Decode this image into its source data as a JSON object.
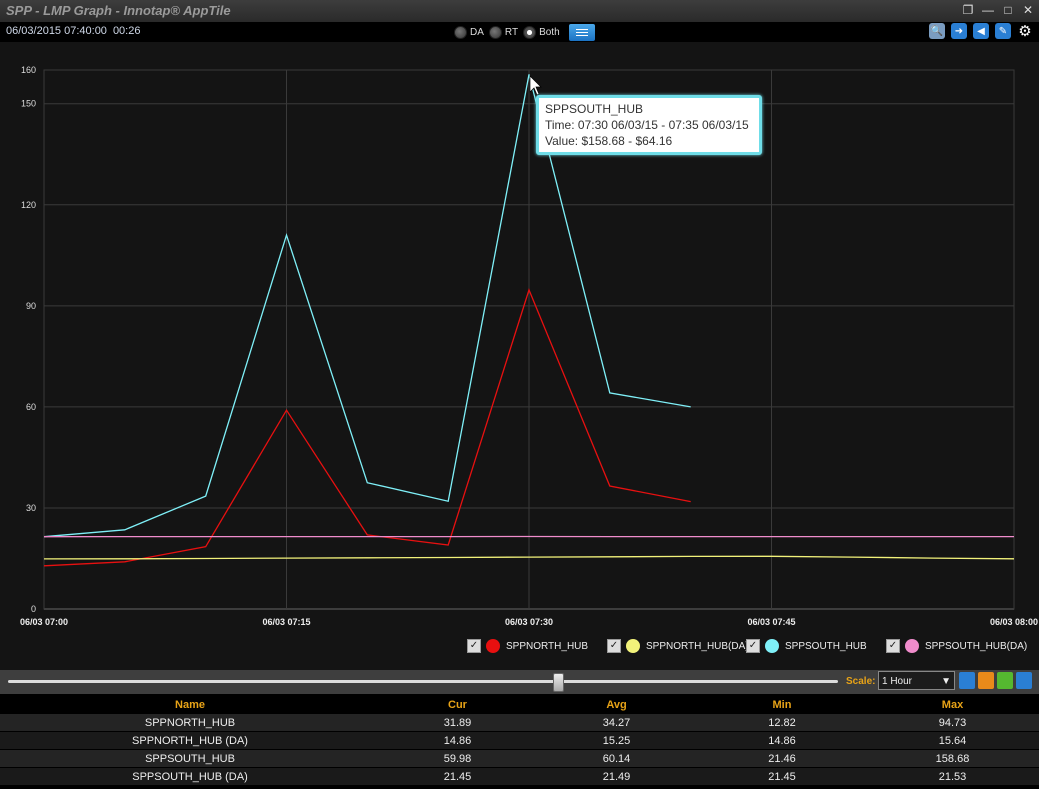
{
  "window": {
    "title": "SPP - LMP Graph - Innotap® AppTile",
    "buttons": [
      "restore-icon",
      "minimize-icon",
      "maximize-icon",
      "close-icon"
    ]
  },
  "toolbar": {
    "date": "06/03/2015 07:40:00",
    "elapsed": "00:26",
    "modes": [
      {
        "label": "DA",
        "selected": false
      },
      {
        "label": "RT",
        "selected": false
      },
      {
        "label": "Both",
        "selected": true
      }
    ],
    "icons": [
      "magnifier-icon",
      "arrow-right-icon",
      "speaker-icon",
      "edit-icon",
      "gear-icon"
    ]
  },
  "tooltip": {
    "series": "SPPSOUTH_HUB",
    "time": "Time: 07:30 06/03/15 - 07:35 06/03/15",
    "value": "Value: $158.68 - $64.16"
  },
  "chart_data": {
    "type": "line",
    "x": [
      "07:00",
      "07:05",
      "07:10",
      "07:15",
      "07:20",
      "07:25",
      "07:30",
      "07:35",
      "07:40",
      "07:45",
      "07:50",
      "07:55",
      "08:00"
    ],
    "xtick_labels": [
      "06/03 07:00",
      "06/03 07:15",
      "06/03 07:30",
      "06/03 07:45",
      "06/03 08:00"
    ],
    "ytick_labels": [
      "0",
      "30",
      "60",
      "90",
      "120",
      "150",
      "160"
    ],
    "ylim": [
      0,
      160
    ],
    "grid": true,
    "legend_placement": "bottom-right",
    "series": [
      {
        "name": "SPPNORTH_HUB",
        "color": "#e81010",
        "values": [
          12.82,
          14,
          18.5,
          59,
          22,
          19,
          94.73,
          36.5,
          31.89
        ]
      },
      {
        "name": "SPPNORTH_HUB(DA)",
        "color": "#f2f27a",
        "values": [
          14.86,
          14.9,
          15,
          15.1,
          15.2,
          15.3,
          15.4,
          15.5,
          15.6,
          15.64,
          15.4,
          15.1,
          14.9
        ]
      },
      {
        "name": "SPPSOUTH_HUB",
        "color": "#7ff0f8",
        "values": [
          21.46,
          23.5,
          33.5,
          111,
          37.5,
          32,
          158.68,
          64.16,
          59.98
        ]
      },
      {
        "name": "SPPSOUTH_HUB(DA)",
        "color": "#f08ccc",
        "values": [
          21.45,
          21.5,
          21.5,
          21.5,
          21.5,
          21.5,
          21.53,
          21.5,
          21.5,
          21.5,
          21.5,
          21.5,
          21.5
        ]
      }
    ]
  },
  "scale": {
    "label": "Scale:",
    "value": "1 Hour",
    "slider_position": 0.67
  },
  "table": {
    "headers": [
      "Name",
      "Cur",
      "Avg",
      "Min",
      "Max"
    ],
    "rows": [
      [
        "SPPNORTH_HUB",
        "31.89",
        "34.27",
        "12.82",
        "94.73"
      ],
      [
        "SPPNORTH_HUB (DA)",
        "14.86",
        "15.25",
        "14.86",
        "15.64"
      ],
      [
        "SPPSOUTH_HUB",
        "59.98",
        "60.14",
        "21.46",
        "158.68"
      ],
      [
        "SPPSOUTH_HUB (DA)",
        "21.45",
        "21.49",
        "21.45",
        "21.53"
      ]
    ]
  }
}
